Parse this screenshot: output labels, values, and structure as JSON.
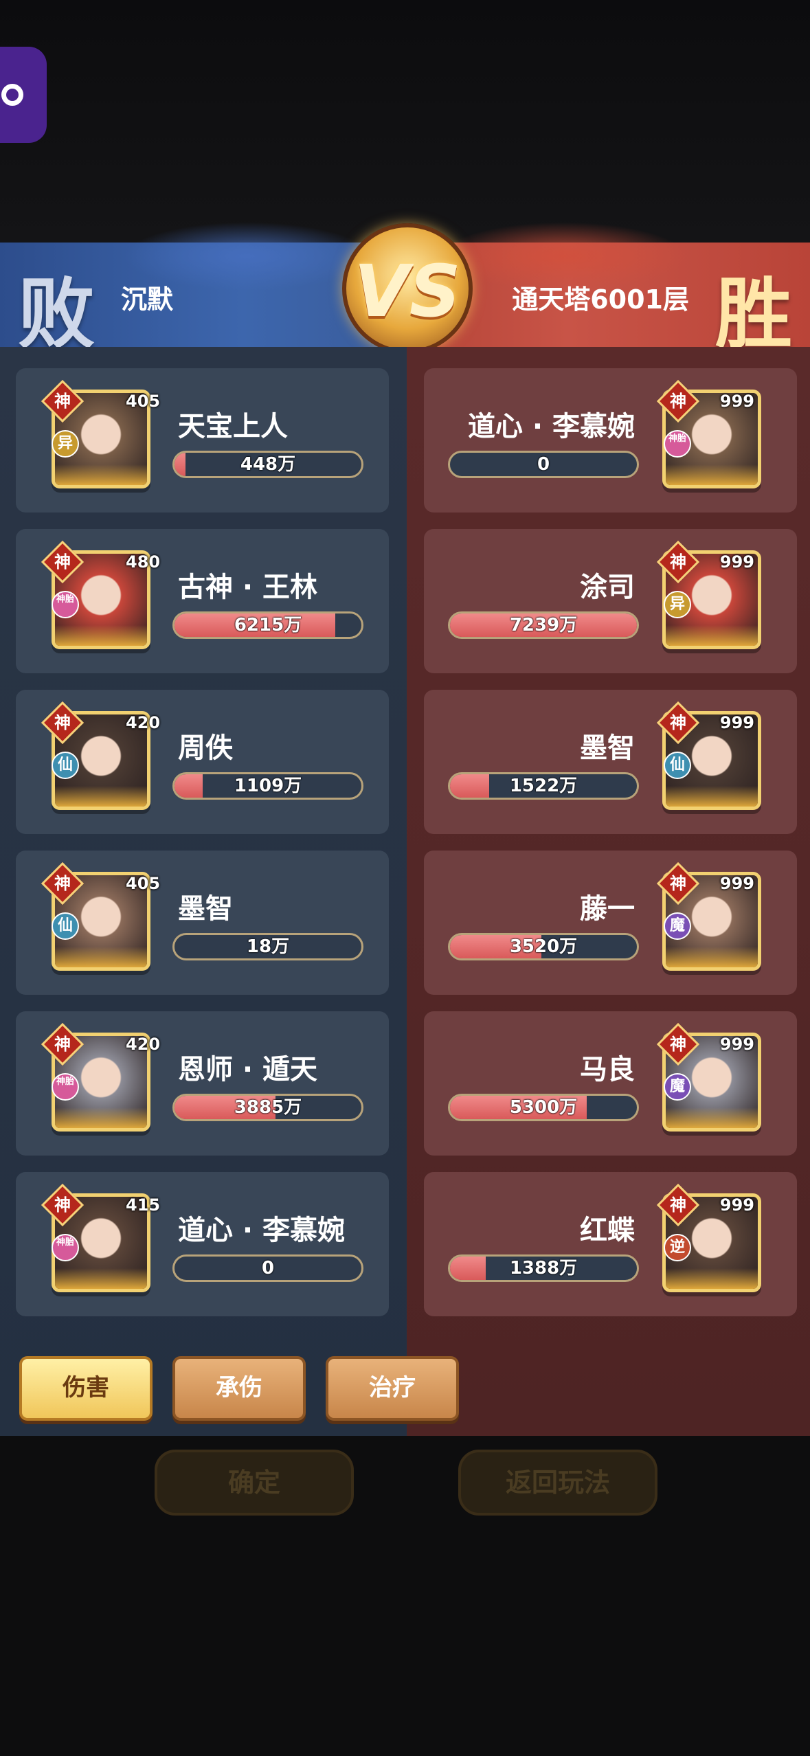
{
  "header": {
    "left_result": "败",
    "left_name": "沉默",
    "vs_text": "VS",
    "right_name": "通天塔6001层",
    "right_result": "胜"
  },
  "left_team": [
    {
      "name": "天宝上人",
      "level": "405",
      "god": "神",
      "faction": "异",
      "damage": "448万",
      "fill": 0.06
    },
    {
      "name": "古神 · 王林",
      "level": "480",
      "god": "神",
      "faction": "神胎",
      "damage": "6215万",
      "fill": 0.86
    },
    {
      "name": "周佚",
      "level": "420",
      "god": "神",
      "faction": "仙",
      "damage": "1109万",
      "fill": 0.15
    },
    {
      "name": "墨智",
      "level": "405",
      "god": "神",
      "faction": "仙",
      "damage": "18万",
      "fill": 0.0
    },
    {
      "name": "恩师 · 遁天",
      "level": "420",
      "god": "神",
      "faction": "神胎",
      "damage": "3885万",
      "fill": 0.54
    },
    {
      "name": "道心 · 李慕婉",
      "level": "415",
      "god": "神",
      "faction": "神胎",
      "damage": "0",
      "fill": 0.0
    }
  ],
  "right_team": [
    {
      "name": "道心 · 李慕婉",
      "level": "999",
      "god": "神",
      "faction": "神胎",
      "damage": "0",
      "fill": 0.0
    },
    {
      "name": "涂司",
      "level": "999",
      "god": "神",
      "faction": "异",
      "damage": "7239万",
      "fill": 1.0
    },
    {
      "name": "墨智",
      "level": "999",
      "god": "神",
      "faction": "仙",
      "damage": "1522万",
      "fill": 0.21
    },
    {
      "name": "藤一",
      "level": "999",
      "god": "神",
      "faction": "魔",
      "damage": "3520万",
      "fill": 0.49
    },
    {
      "name": "马良",
      "level": "999",
      "god": "神",
      "faction": "魔",
      "damage": "5300万",
      "fill": 0.73
    },
    {
      "name": "红蝶",
      "level": "999",
      "god": "神",
      "faction": "逆",
      "damage": "1388万",
      "fill": 0.19
    }
  ],
  "tabs": {
    "damage": "伤害",
    "taken": "承伤",
    "heal": "治疗"
  },
  "actions": {
    "confirm": "确定",
    "back": "返回玩法"
  },
  "colors": {
    "left_team": "#3d66ad",
    "right_team": "#c85447",
    "bar_fill": "#e06a6a"
  }
}
